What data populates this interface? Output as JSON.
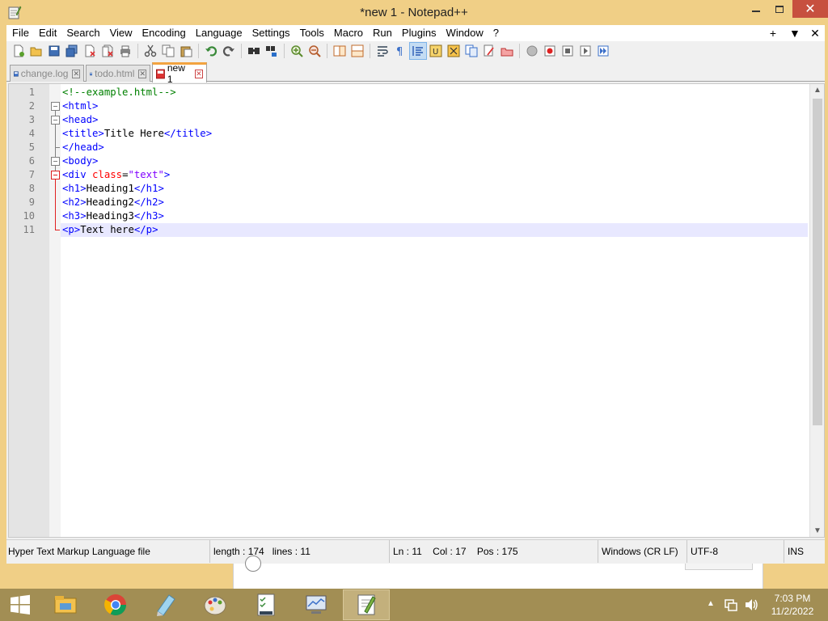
{
  "window": {
    "title": "*new 1 - Notepad++",
    "minimize_glyph": "▬",
    "maximize_glyph": "☐",
    "close_glyph": "✕"
  },
  "menu": {
    "items": [
      "File",
      "Edit",
      "Search",
      "View",
      "Encoding",
      "Language",
      "Settings",
      "Tools",
      "Macro",
      "Run",
      "Plugins",
      "Window",
      "?"
    ],
    "right": [
      "+",
      "▼",
      "✕"
    ]
  },
  "toolbar": {
    "buttons": [
      "new-file",
      "open-file",
      "save",
      "save-all",
      "close",
      "close-all",
      "print",
      "cut",
      "copy",
      "paste",
      "undo",
      "redo",
      "find",
      "replace",
      "zoom-in",
      "zoom-out",
      "sync-vertical",
      "sync-horizontal",
      "word-wrap",
      "show-all-chars",
      "indent-guide",
      "user-defined-language",
      "document-map",
      "function-list",
      "folder-as-workspace",
      "monitoring",
      "start-record",
      "stop-record",
      "playback",
      "run-macro-multiple",
      "save-macro"
    ]
  },
  "tabs": [
    {
      "label": "change.log",
      "active": false
    },
    {
      "label": "todo.html",
      "active": false
    },
    {
      "label": "new 1",
      "active": true
    }
  ],
  "editor": {
    "lines": [
      {
        "num": "1",
        "segments": [
          {
            "t": "<!--example.html-->",
            "c": "comment"
          }
        ]
      },
      {
        "num": "2",
        "segments": [
          {
            "t": "<html>",
            "c": "tag"
          }
        ]
      },
      {
        "num": "3",
        "segments": [
          {
            "t": "<head>",
            "c": "tag"
          }
        ]
      },
      {
        "num": "4",
        "segments": [
          {
            "t": "<title>",
            "c": "tag"
          },
          {
            "t": "Title Here",
            "c": "txt"
          },
          {
            "t": "</title>",
            "c": "tag"
          }
        ]
      },
      {
        "num": "5",
        "segments": [
          {
            "t": "</head>",
            "c": "tag"
          }
        ]
      },
      {
        "num": "6",
        "segments": [
          {
            "t": "<body>",
            "c": "tag"
          }
        ]
      },
      {
        "num": "7",
        "segments": [
          {
            "t": "<div ",
            "c": "tag"
          },
          {
            "t": "class",
            "c": "attr"
          },
          {
            "t": "=",
            "c": "txt"
          },
          {
            "t": "\"text\"",
            "c": "val"
          },
          {
            "t": ">",
            "c": "tag"
          }
        ]
      },
      {
        "num": "8",
        "segments": [
          {
            "t": "<h1>",
            "c": "tag"
          },
          {
            "t": "Heading1",
            "c": "txt"
          },
          {
            "t": "</h1>",
            "c": "tag"
          }
        ]
      },
      {
        "num": "9",
        "segments": [
          {
            "t": "<h2>",
            "c": "tag"
          },
          {
            "t": "Heading2",
            "c": "txt"
          },
          {
            "t": "</h2>",
            "c": "tag"
          }
        ]
      },
      {
        "num": "10",
        "segments": [
          {
            "t": "<h3>",
            "c": "tag"
          },
          {
            "t": "Heading3",
            "c": "txt"
          },
          {
            "t": "</h3>",
            "c": "tag"
          }
        ]
      },
      {
        "num": "11",
        "segments": [
          {
            "t": "<p>",
            "c": "tag"
          },
          {
            "t": "Text here",
            "c": "txt"
          },
          {
            "t": "</p>",
            "c": "tag"
          }
        ]
      }
    ],
    "current_line": "11"
  },
  "statusbar": {
    "file_type": "Hyper Text Markup Language file",
    "length": "length : 174",
    "lines": "lines : 11",
    "ln": "Ln : 11",
    "col": "Col : 17",
    "pos": "Pos : 175",
    "eol": "Windows (CR LF)",
    "encoding": "UTF-8",
    "mode": "INS"
  },
  "taskbar": {
    "apps": [
      "file-explorer",
      "chrome",
      "notepad",
      "paint",
      "task-manager",
      "remote-desktop",
      "notepad-plus-plus"
    ],
    "active_app": "notepad-plus-plus",
    "clock_time": "7:03 PM",
    "clock_date": "11/2/2022"
  },
  "colors": {
    "window_frame": "#f0cf86",
    "taskbar": "#a28e54",
    "close_button": "#c7503f",
    "tag": "#0000ff",
    "comment": "#008000",
    "attribute": "#ff0000",
    "value": "#8000ff",
    "current_line": "#e8e8ff"
  }
}
